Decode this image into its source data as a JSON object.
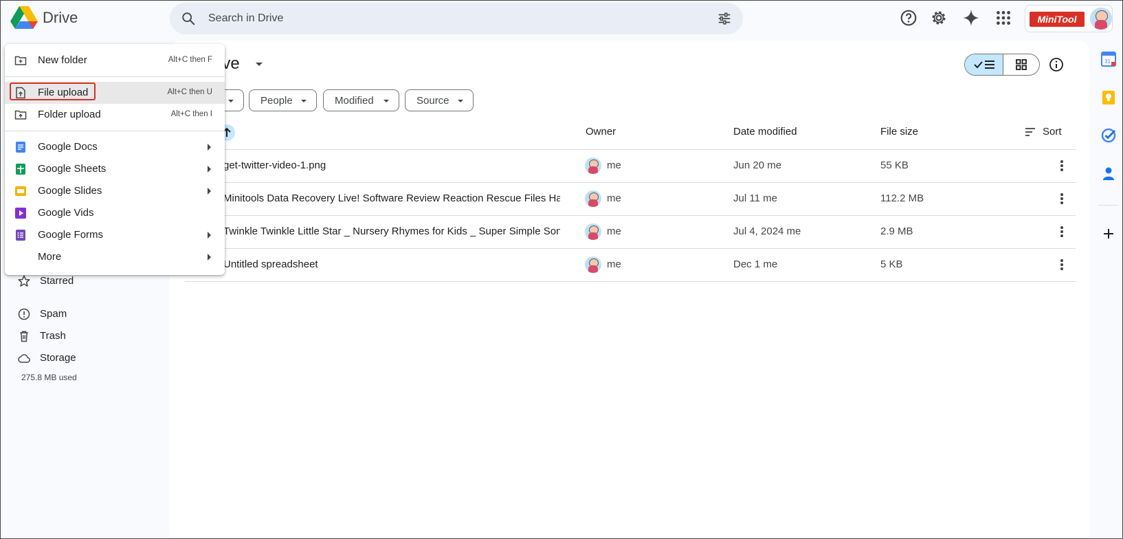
{
  "header": {
    "app_name": "Drive",
    "search_placeholder": "Search in Drive",
    "brand_text": "MiniTool"
  },
  "page": {
    "title_partial": "rive"
  },
  "filters": [
    "People",
    "Modified",
    "Source"
  ],
  "table": {
    "columns": {
      "owner": "Owner",
      "date": "Date modified",
      "size": "File size",
      "sort": "Sort"
    },
    "rows": [
      {
        "name": "get-twitter-video-1.png",
        "owner": "me",
        "date": "Jun 20 me",
        "size": "55 KB"
      },
      {
        "name": "Minitools Data Recovery Live! Software Review Reaction Rescue Files Har...",
        "owner": "me",
        "date": "Jul 11 me",
        "size": "112.2 MB"
      },
      {
        "name": "Twinkle Twinkle Little Star _ Nursery Rhymes for Kids _ Super Simple Song...",
        "owner": "me",
        "date": "Jul 4, 2024 me",
        "size": "2.9 MB"
      },
      {
        "name": "Untitled spreadsheet",
        "owner": "me",
        "date": "Dec 1 me",
        "size": "5 KB"
      }
    ]
  },
  "sidebar": {
    "items": [
      {
        "label": "Starred",
        "icon": "star-icon"
      },
      {
        "label": "Spam",
        "icon": "spam-icon"
      },
      {
        "label": "Trash",
        "icon": "trash-icon"
      },
      {
        "label": "Storage",
        "icon": "cloud-icon"
      }
    ],
    "storage_used": "275.8 MB used"
  },
  "new_menu": {
    "items": [
      {
        "label": "New folder",
        "shortcut": "Alt+C then F",
        "icon": "new-folder-icon"
      },
      {
        "label": "File upload",
        "shortcut": "Alt+C then U",
        "icon": "file-upload-icon",
        "highlighted": true
      },
      {
        "label": "Folder upload",
        "shortcut": "Alt+C then I",
        "icon": "folder-upload-icon"
      },
      {
        "label": "Google Docs",
        "icon": "docs-icon",
        "submenu": true,
        "color": "#4285f4"
      },
      {
        "label": "Google Sheets",
        "icon": "sheets-icon",
        "submenu": true,
        "color": "#0f9d58"
      },
      {
        "label": "Google Slides",
        "icon": "slides-icon",
        "submenu": true,
        "color": "#f4b400"
      },
      {
        "label": "Google Vids",
        "icon": "vids-icon",
        "submenu": false,
        "color": "#8430ce"
      },
      {
        "label": "Google Forms",
        "icon": "forms-icon",
        "submenu": true,
        "color": "#7248b9"
      },
      {
        "label": "More",
        "submenu": true
      }
    ]
  },
  "right_rail": {
    "calendar_day": "31",
    "icons": [
      "calendar-icon",
      "keep-icon",
      "tasks-icon",
      "contacts-icon",
      "add-icon"
    ]
  },
  "colors": {
    "accent": "#c2e7ff",
    "highlight_box": "#d93025",
    "search_bg": "#e9eef6"
  }
}
